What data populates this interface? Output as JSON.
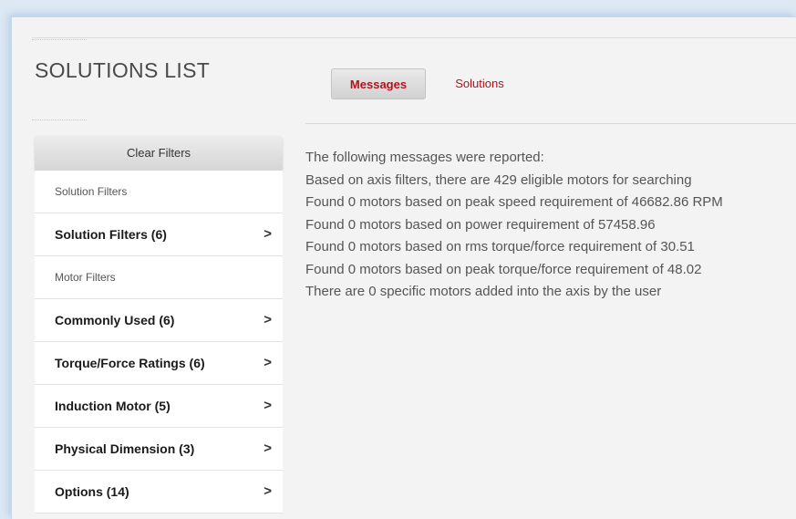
{
  "page": {
    "title": "SOLUTIONS LIST"
  },
  "tabs": [
    {
      "label": "Messages",
      "active": true
    },
    {
      "label": "Solutions",
      "active": false
    }
  ],
  "sidebar": {
    "clear_filters_label": "Clear Filters",
    "sections": [
      {
        "label": "Solution Filters",
        "items": [
          {
            "label": "Solution Filters (6)",
            "icon": "chevron-right-icon"
          }
        ]
      },
      {
        "label": "Motor Filters",
        "items": [
          {
            "label": "Commonly Used (6)",
            "icon": "chevron-right-icon"
          },
          {
            "label": "Torque/Force Ratings (6)",
            "icon": "chevron-right-icon"
          },
          {
            "label": "Induction Motor (5)",
            "icon": "chevron-right-icon"
          },
          {
            "label": "Physical Dimension (3)",
            "icon": "chevron-right-icon"
          },
          {
            "label": "Options (14)",
            "icon": "chevron-right-icon"
          }
        ]
      }
    ],
    "chevron_glyph": ">"
  },
  "messages": [
    "The following messages were reported:",
    "Based on axis filters, there are 429 eligible motors for searching",
    "Found 0 motors based on peak speed requirement of 46682.86 RPM",
    "Found 0 motors based on power requirement of 57458.96",
    "Found 0 motors based on rms torque/force requirement of 30.51",
    "Found 0 motors based on peak torque/force requirement of 48.02",
    "There are 0 specific motors added into the axis by the user"
  ],
  "colors": {
    "accent": "#b3121a",
    "background": "#f3f3f3",
    "frame": "#dde8f4"
  }
}
